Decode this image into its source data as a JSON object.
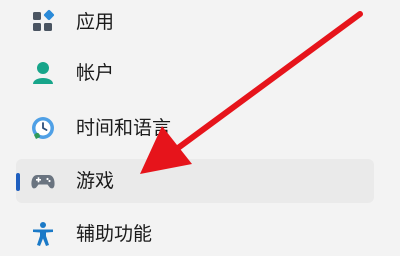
{
  "nav": {
    "items": [
      {
        "label": "应用",
        "icon": "apps-icon",
        "selected": false
      },
      {
        "label": "帐户",
        "icon": "account-icon",
        "selected": false
      },
      {
        "label": "时间和语言",
        "icon": "time-language-icon",
        "selected": false
      },
      {
        "label": "游戏",
        "icon": "gamepad-icon",
        "selected": true
      },
      {
        "label": "辅助功能",
        "icon": "accessibility-icon",
        "selected": false
      }
    ]
  },
  "colors": {
    "page_background": "#f3f3f3",
    "selected_background": "#eaeaea",
    "selection_indicator": "#1f5fbf",
    "annotation_arrow": "#e6141b"
  }
}
